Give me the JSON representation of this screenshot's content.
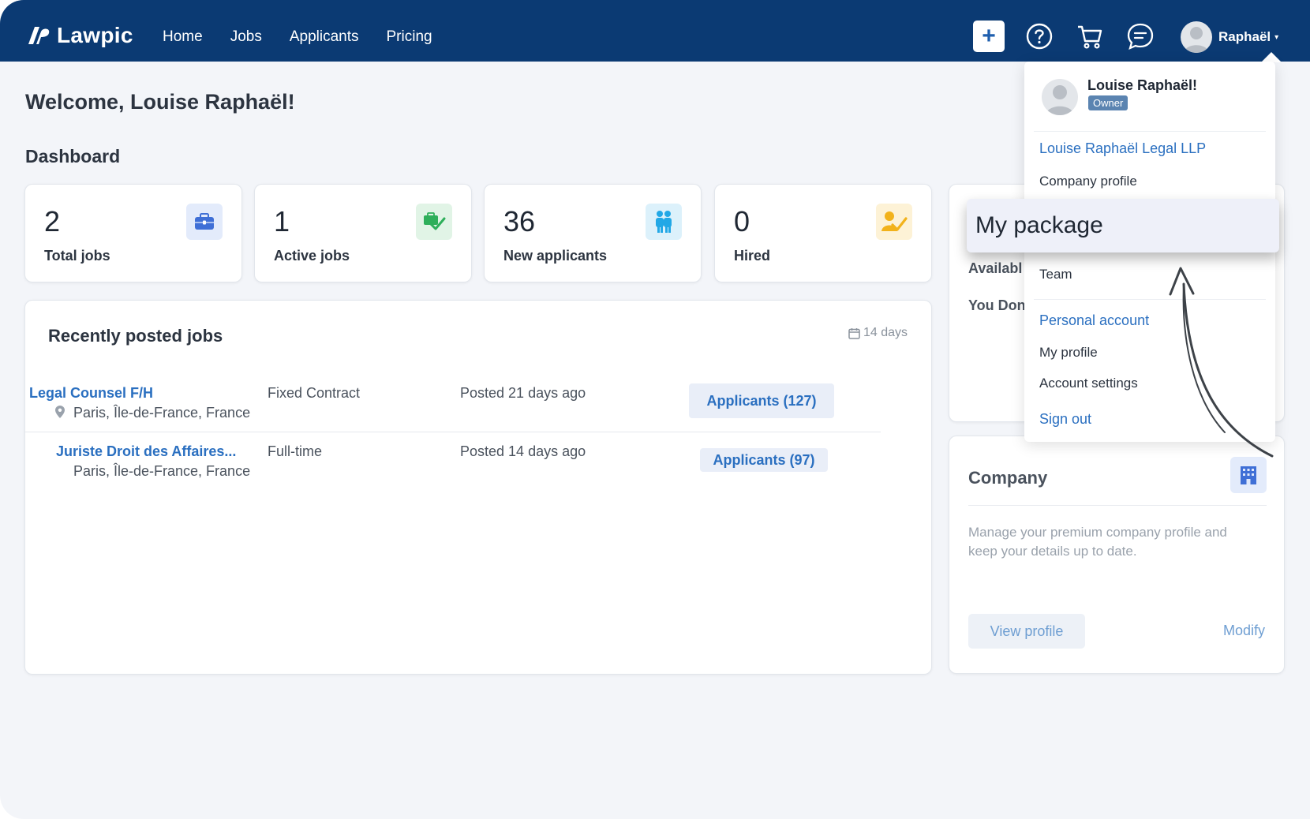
{
  "brand": {
    "name": "Lawpic"
  },
  "nav": {
    "home": "Home",
    "jobs": "Jobs",
    "applicants": "Applicants",
    "pricing": "Pricing"
  },
  "header": {
    "plus_symbol": "+",
    "user_name": "Raphaël",
    "caret": "▾"
  },
  "welcome": "Welcome, Louise Raphaël!",
  "dashboard_title": "Dashboard",
  "stats": [
    {
      "value": "2",
      "label": "Total jobs",
      "icon": "briefcase-icon",
      "color": "#3f6fd6"
    },
    {
      "value": "1",
      "label": "Active jobs",
      "icon": "briefcase-check-icon",
      "color": "#2eaf5a"
    },
    {
      "value": "36",
      "label": "New applicants",
      "icon": "people-icon",
      "color": "#22a8e6"
    },
    {
      "value": "0",
      "label": "Hired",
      "icon": "user-check-icon",
      "color": "#f2b21b"
    }
  ],
  "recent_jobs": {
    "title": "Recently posted jobs",
    "range": "14 days",
    "rows": [
      {
        "title": "Legal Counsel F/H",
        "location": "Paris, Île-de-France, France",
        "type": "Fixed Contract",
        "posted": "Posted 21 days ago",
        "applicants": "Applicants  (127)"
      },
      {
        "title": "Juriste Droit des Affaires...",
        "location": "Paris, Île-de-France, France",
        "type": "Full-time",
        "posted": "Posted 14 days ago",
        "applicants": "Applicants  (97)"
      }
    ]
  },
  "side_panel": {
    "line1": "Availabl",
    "line2": "You Don"
  },
  "company_card": {
    "title": "Company",
    "description": "Manage your premium company profile and keep your details up to date.",
    "view_label": "View profile",
    "modify_label": "Modify"
  },
  "dropdown": {
    "user_name": "Louise Raphaël!",
    "role": "Owner",
    "company_section": "Louise Raphaël Legal LLP",
    "company_profile": "Company profile",
    "my_package": "My package",
    "team": "Team",
    "personal_section": "Personal account",
    "my_profile": "My profile",
    "account_settings": "Account settings",
    "sign_out": "Sign out"
  },
  "colors": {
    "header": "#0b3a73",
    "accent": "#2a6fc0",
    "background": "#f3f5f9"
  }
}
